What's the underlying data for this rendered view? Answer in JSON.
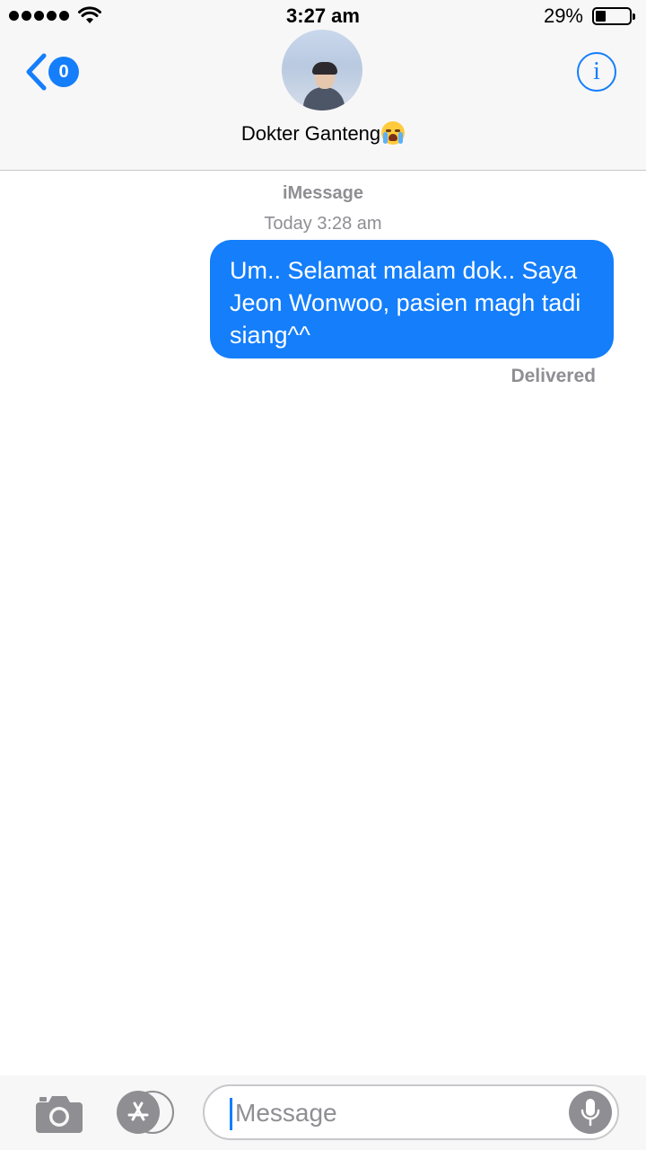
{
  "status_bar": {
    "time": "3:27 am",
    "battery_percent": "29%",
    "battery_level": 0.29
  },
  "header": {
    "back_badge": "0",
    "contact_name": "Dokter Ganteng",
    "contact_emoji_icon": "loudly-crying-face-emoji",
    "info_glyph": "i"
  },
  "conversation": {
    "service": "iMessage",
    "timestamp": "Today 3:28 am",
    "messages": [
      {
        "direction": "outgoing",
        "text": "Um.. Selamat malam dok.. Saya Jeon Wonwoo, pasien magh tadi siang^^"
      }
    ],
    "status": "Delivered"
  },
  "input_bar": {
    "placeholder": "Message",
    "value": "",
    "icons": [
      "camera-icon",
      "app-store-icon",
      "microphone-icon"
    ]
  },
  "colors": {
    "accent": "#147efb",
    "gray": "#8e8e93",
    "header_bg": "#f7f7f7"
  }
}
